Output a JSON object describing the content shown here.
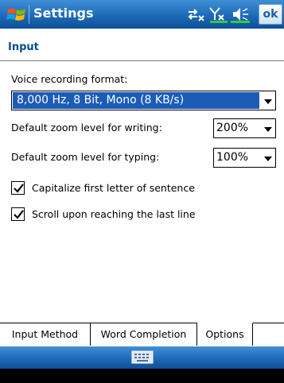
{
  "titlebar": {
    "title": "Settings",
    "ok_label": "ok",
    "icons": [
      "windows-flag-icon",
      "connectivity-icon",
      "signal-icon",
      "volume-icon"
    ]
  },
  "section": {
    "header": "Input"
  },
  "fields": {
    "voice_format_label": "Voice recording format:",
    "voice_format_value": "8,000 Hz, 8 Bit, Mono (8 KB/s)",
    "zoom_writing_label": "Default zoom level for writing:",
    "zoom_writing_value": "200%",
    "zoom_typing_label": "Default zoom level for typing:",
    "zoom_typing_value": "100%"
  },
  "checkboxes": [
    {
      "label": "Capitalize first letter of sentence",
      "checked": true
    },
    {
      "label": "Scroll upon reaching the last line",
      "checked": true
    }
  ],
  "tabs": [
    {
      "label": "Input Method",
      "active": false
    },
    {
      "label": "Word Completion",
      "active": false
    },
    {
      "label": "Options",
      "active": true
    }
  ],
  "bottombar": {
    "icon": "keyboard-icon"
  },
  "colors": {
    "titlebar": "#1d6ab8",
    "header_text": "#0b4a8b",
    "selection": "#1c5cb8"
  }
}
